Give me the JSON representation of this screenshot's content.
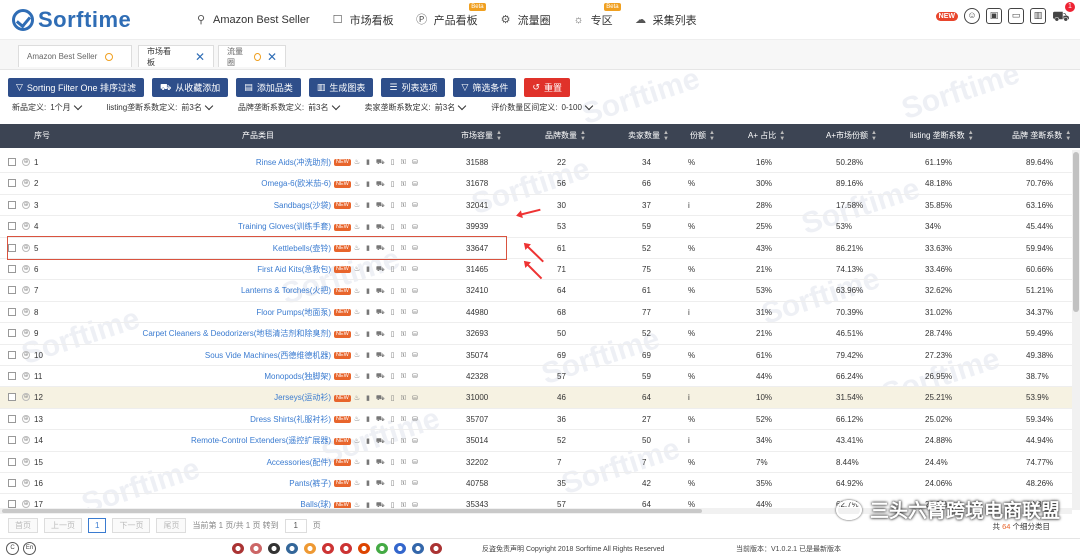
{
  "brand": "Sorftime",
  "nav": [
    {
      "label": "Amazon Best Seller",
      "icon": "rocket-icon",
      "glyph": "⚲",
      "beta": ""
    },
    {
      "label": "市场看板",
      "icon": "board-icon",
      "glyph": "☐",
      "beta": ""
    },
    {
      "label": "产品看板",
      "icon": "product-board-icon",
      "glyph": "Ⓟ",
      "beta": "Beta"
    },
    {
      "label": "流量圈",
      "icon": "traffic-icon",
      "glyph": "⚙",
      "beta": ""
    },
    {
      "label": "专区",
      "icon": "bulb-icon",
      "glyph": "☼",
      "beta": "Beta"
    },
    {
      "label": "采集列表",
      "icon": "cloud-icon",
      "glyph": "☁",
      "beta": ""
    }
  ],
  "topright": {
    "new": "NEW",
    "cart_count": "1"
  },
  "tabs": [
    {
      "label": "Amazon Best Seller",
      "closable": false
    },
    {
      "label": "市场看板",
      "closable": true
    },
    {
      "label": "流量圈",
      "closable": true
    }
  ],
  "toolbar": [
    {
      "label": "Sorting Filter One 排序过滤",
      "icon": "filter-icon",
      "glyph": "▽",
      "red": false
    },
    {
      "label": "从收藏添加",
      "icon": "cart-icon",
      "glyph": "⛟",
      "red": false
    },
    {
      "label": "添加品类",
      "icon": "doc-icon",
      "glyph": "▤",
      "red": false
    },
    {
      "label": "生成图表",
      "icon": "chart-icon",
      "glyph": "▥",
      "red": false
    },
    {
      "label": "列表选项",
      "icon": "list-icon",
      "glyph": "☰",
      "red": false
    },
    {
      "label": "筛选条件",
      "icon": "funnel-icon",
      "glyph": "▽",
      "red": false
    },
    {
      "label": "重置",
      "icon": "reset-icon",
      "glyph": "↺",
      "red": true
    }
  ],
  "filters": [
    {
      "label": "新品定义:",
      "value": "1个月"
    },
    {
      "label": "listing垄断系数定义:",
      "value": "前3名"
    },
    {
      "label": "品牌垄断系数定义:",
      "value": "前3名"
    },
    {
      "label": "卖家垄断系数定义:",
      "value": "前3名"
    },
    {
      "label": "评价数量区间定义:",
      "value": "0-100"
    }
  ],
  "columns": [
    {
      "label": "序号",
      "sortable": false
    },
    {
      "label": "产品类目",
      "sortable": false
    },
    {
      "label": "市场容量",
      "sortable": true
    },
    {
      "label": "品牌数量",
      "sortable": true
    },
    {
      "label": "卖家数量",
      "sortable": true
    },
    {
      "label": "份额",
      "sortable": true
    },
    {
      "label": "A+ 占比",
      "sortable": true
    },
    {
      "label": "A+市场份额",
      "sortable": true
    },
    {
      "label": "listing 垄断系数",
      "sortable": true
    },
    {
      "label": "品牌 垄断系数",
      "sortable": true
    }
  ],
  "rows": [
    {
      "no": "1",
      "cat": "Rinse Aids(冲洗助剂)",
      "cap": "31588",
      "brands": "22",
      "sellers": "34",
      "share": "%",
      "ap": "16%",
      "apm": "50.28%",
      "lm": "61.19%",
      "bm": "89.64%"
    },
    {
      "no": "2",
      "cat": "Omega-6(欧米茄-6)",
      "cap": "31678",
      "brands": "56",
      "sellers": "66",
      "share": "%",
      "ap": "30%",
      "apm": "89.16%",
      "lm": "48.18%",
      "bm": "70.76%"
    },
    {
      "no": "3",
      "cat": "Sandbags(沙袋)",
      "cap": "32041",
      "brands": "30",
      "sellers": "37",
      "share": "i",
      "ap": "28%",
      "apm": "17.58%",
      "lm": "35.85%",
      "bm": "63.16%"
    },
    {
      "no": "4",
      "cat": "Training Gloves(训练手套)",
      "cap": "39939",
      "brands": "53",
      "sellers": "59",
      "share": "%",
      "ap": "25%",
      "apm": "53%",
      "lm": "34%",
      "bm": "45.44%"
    },
    {
      "no": "5",
      "cat": "Kettlebells(壶铃)",
      "cap": "33647",
      "brands": "61",
      "sellers": "52",
      "share": "%",
      "ap": "43%",
      "apm": "86.21%",
      "lm": "33.63%",
      "bm": "59.94%"
    },
    {
      "no": "6",
      "cat": "First Aid Kits(急救包)",
      "cap": "31465",
      "brands": "71",
      "sellers": "75",
      "share": "%",
      "ap": "21%",
      "apm": "74.13%",
      "lm": "33.46%",
      "bm": "60.66%"
    },
    {
      "no": "7",
      "cat": "Lanterns & Torches(火把)",
      "cap": "32410",
      "brands": "64",
      "sellers": "61",
      "share": "%",
      "ap": "53%",
      "apm": "63.96%",
      "lm": "32.62%",
      "bm": "51.21%"
    },
    {
      "no": "8",
      "cat": "Floor Pumps(地面泵)",
      "cap": "44980",
      "brands": "68",
      "sellers": "77",
      "share": "i",
      "ap": "31%",
      "apm": "70.39%",
      "lm": "31.02%",
      "bm": "34.37%"
    },
    {
      "no": "9",
      "cat": "Carpet Cleaners & Deodorizers(地毯清洁剂和除臭剂)",
      "cap": "32693",
      "brands": "50",
      "sellers": "52",
      "share": "%",
      "ap": "21%",
      "apm": "46.51%",
      "lm": "28.74%",
      "bm": "59.49%"
    },
    {
      "no": "10",
      "cat": "Sous Vide Machines(西德维德机器)",
      "cap": "35074",
      "brands": "69",
      "sellers": "69",
      "share": "%",
      "ap": "61%",
      "apm": "79.42%",
      "lm": "27.23%",
      "bm": "49.38%"
    },
    {
      "no": "11",
      "cat": "Monopods(独脚架)",
      "cap": "42328",
      "brands": "57",
      "sellers": "59",
      "share": "%",
      "ap": "44%",
      "apm": "66.24%",
      "lm": "26.95%",
      "bm": "38.7%"
    },
    {
      "no": "12",
      "cat": "Jerseys(运动衫)",
      "cap": "31000",
      "brands": "46",
      "sellers": "64",
      "share": "i",
      "ap": "10%",
      "apm": "31.54%",
      "lm": "25.21%",
      "bm": "53.9%"
    },
    {
      "no": "13",
      "cat": "Dress Shirts(礼服衬衫)",
      "cap": "35707",
      "brands": "36",
      "sellers": "27",
      "share": "%",
      "ap": "52%",
      "apm": "66.12%",
      "lm": "25.02%",
      "bm": "59.34%"
    },
    {
      "no": "14",
      "cat": "Remote-Control Extenders(遥控扩展器)",
      "cap": "35014",
      "brands": "52",
      "sellers": "50",
      "share": "i",
      "ap": "34%",
      "apm": "43.41%",
      "lm": "24.88%",
      "bm": "44.94%"
    },
    {
      "no": "15",
      "cat": "Accessories(配件)",
      "cap": "32202",
      "brands": "7",
      "sellers": "7",
      "share": "%",
      "ap": "7%",
      "apm": "8.44%",
      "lm": "24.4%",
      "bm": "74.77%"
    },
    {
      "no": "16",
      "cat": "Pants(裤子)",
      "cap": "40758",
      "brands": "35",
      "sellers": "42",
      "share": "%",
      "ap": "35%",
      "apm": "64.92%",
      "lm": "24.06%",
      "bm": "48.26%"
    },
    {
      "no": "17",
      "cat": "Balls(球)",
      "cap": "35343",
      "brands": "57",
      "sellers": "64",
      "share": "%",
      "ap": "44%",
      "apm": "62.7%",
      "lm": "23.9%",
      "bm": "38.3%"
    }
  ],
  "new_tag": "NEW",
  "row_icons": "♨ ▮ ⛟ ▯ ⚿ ⛁",
  "pager": {
    "first": "首页",
    "prev": "上一页",
    "current": "1",
    "next": "下一页",
    "last": "尾页",
    "info": "当前第 1 页/共 1 页 转到",
    "goto": "1",
    "unit": "页"
  },
  "cat_count": {
    "prefix": "共",
    "count": "64",
    "suffix": "个细分类目"
  },
  "wechat": "三头六臂跨境电商联盟",
  "footer": {
    "langs": [
      "C",
      "En"
    ],
    "disclaimer": "反盗免责声明 Copyright 2018 Sorftime All Rights Reserved",
    "version": "当前版本：V1.0.2.1 已是最新版本"
  },
  "colors": {
    "header_bg": "#3c4453",
    "btn_bg": "#2e4e8a",
    "reset_bg": "#e0322a",
    "link": "#3a7bd0",
    "accent": "#2f6db5"
  }
}
